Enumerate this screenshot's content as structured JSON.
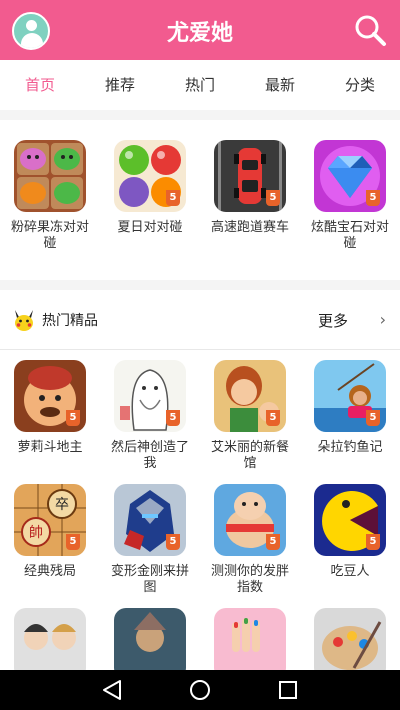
{
  "header": {
    "title": "尤爱她"
  },
  "tabs": [
    {
      "label": "首页"
    },
    {
      "label": "推荐"
    },
    {
      "label": "热门"
    },
    {
      "label": "最新"
    },
    {
      "label": "分类"
    }
  ],
  "featured": [
    {
      "name": "粉碎果冻对对碰",
      "icon": "jelly-game-icon"
    },
    {
      "name": "夏日对对碰",
      "icon": "fruit-balls-game-icon"
    },
    {
      "name": "高速跑道赛车",
      "icon": "race-car-game-icon"
    },
    {
      "name": "炫酷宝石对对碰",
      "icon": "gem-game-icon"
    }
  ],
  "hot_section": {
    "title": "热门精品",
    "more_label": "更多"
  },
  "hot_games": [
    {
      "name": "萝莉斗地主",
      "icon": "landlord-game-icon"
    },
    {
      "name": "然后神创造了我",
      "icon": "god-created-game-icon"
    },
    {
      "name": "艾米丽的新餐馆",
      "icon": "emily-restaurant-game-icon"
    },
    {
      "name": "朵拉钓鱼记",
      "icon": "dora-fishing-game-icon"
    },
    {
      "name": "经典残局",
      "icon": "chinese-chess-game-icon"
    },
    {
      "name": "变形金刚来拼图",
      "icon": "transformers-puzzle-game-icon"
    },
    {
      "name": "测测你的发胖指数",
      "icon": "fat-index-game-icon"
    },
    {
      "name": "吃豆人",
      "icon": "pacman-game-icon"
    },
    {
      "name": "",
      "icon": "kpop-game-icon"
    },
    {
      "name": "",
      "icon": "warrior-game-icon"
    },
    {
      "name": "",
      "icon": "nail-salon-game-icon"
    },
    {
      "name": "",
      "icon": "paint-palette-game-icon"
    }
  ],
  "badge": "5",
  "colors": {
    "brand": "#f25b8f",
    "active_tab": "#f25b8f"
  }
}
